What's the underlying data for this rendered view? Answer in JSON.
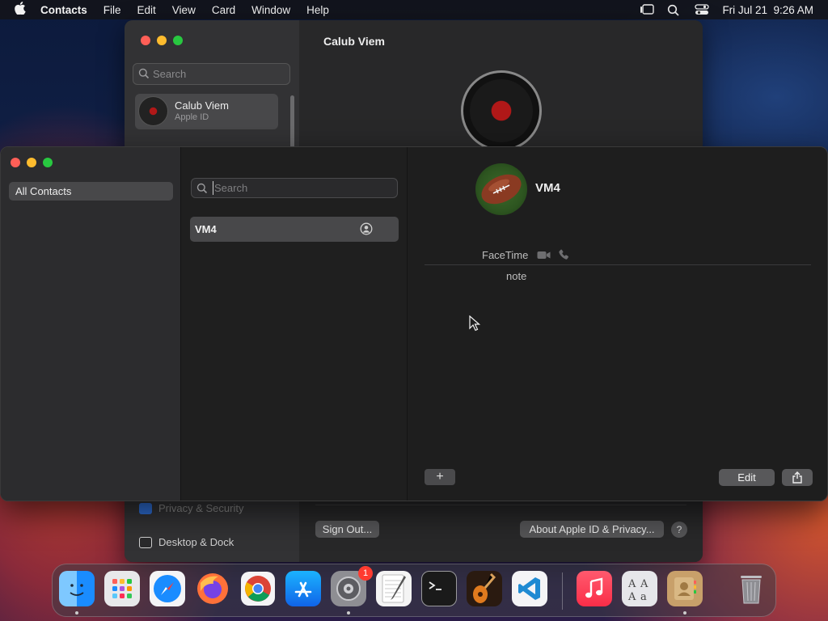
{
  "menubar": {
    "app_name": "Contacts",
    "items": [
      "File",
      "Edit",
      "View",
      "Card",
      "Window",
      "Help"
    ],
    "clock": "Fri Jul 21  9:26 AM"
  },
  "settings_window": {
    "search_placeholder": "Search",
    "account_name": "Calub Viem",
    "account_sub": "Apple ID",
    "title": "Calub Viem",
    "sidebar_items": [
      "Privacy & Security",
      "Desktop & Dock"
    ],
    "sign_out_label": "Sign Out...",
    "about_label": "About Apple ID & Privacy...",
    "help_label": "?"
  },
  "contacts_window": {
    "group": "All Contacts",
    "search_placeholder": "Search",
    "contact_row_name": "VM4",
    "detail": {
      "name": "VM4",
      "facetime_label": "FaceTime",
      "note_label": "note"
    },
    "add_label": "+",
    "edit_label": "Edit"
  },
  "dock": {
    "apps": [
      "Finder",
      "Launchpad",
      "Safari",
      "Firefox",
      "Chrome",
      "App Store",
      "System Settings",
      "TextEdit",
      "Terminal",
      "GarageBand",
      "Visual Studio Code",
      "Music",
      "Font Book",
      "Contacts",
      "Trash"
    ],
    "system_settings_badge": "1"
  },
  "colors": {
    "accent_red": "#ff5f57",
    "accent_yellow": "#febc2e",
    "accent_green": "#28c840",
    "badge": "#ff3b30"
  }
}
